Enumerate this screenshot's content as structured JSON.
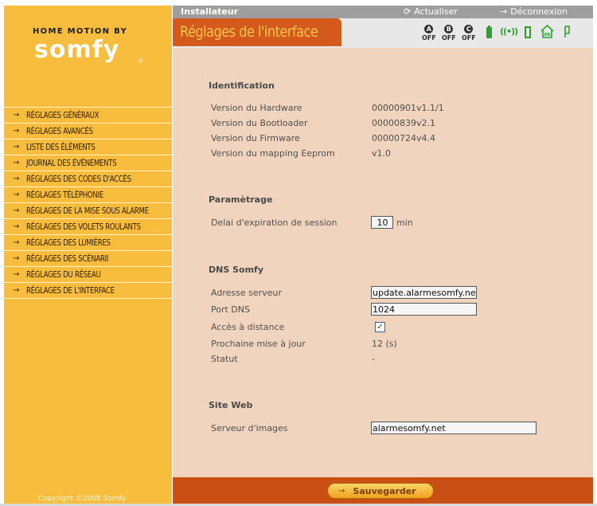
{
  "brand": {
    "tagline": "HOME MOTION BY",
    "name": "somfy",
    "reg": "®"
  },
  "sidebar": {
    "items": [
      {
        "label": "RÉGLAGES GÉNÉRAUX"
      },
      {
        "label": "RÉGLAGES AVANCÉS"
      },
      {
        "label": "LISTE DES ÉLÉMENTS"
      },
      {
        "label": "JOURNAL DES ÉVÉNEMENTS"
      },
      {
        "label": "RÉGLAGES DES CODES D'ACCÈS"
      },
      {
        "label": "RÉGLAGES TÉLÉPHONIE"
      },
      {
        "label": "RÉGLAGES DE LA MISE SOUS ALARME"
      },
      {
        "label": "RÉGLAGES DES VOLETS ROULANTS"
      },
      {
        "label": "RÉGLAGES DES LUMIÈRES"
      },
      {
        "label": "RÉGLAGES DES SCÉNARII"
      },
      {
        "label": "RÉGLAGES DU RÉSEAU"
      },
      {
        "label": "RÉGLAGES DE L'INTERFACE"
      }
    ],
    "copyright": "Copyright ©2008 Somfy"
  },
  "topbar": {
    "role": "Installateur",
    "refresh": "Actualiser",
    "logout": "Déconnexion"
  },
  "header": {
    "title": "Réglages de l'interface",
    "zones": [
      {
        "letter": "A",
        "state": "OFF"
      },
      {
        "letter": "B",
        "state": "OFF"
      },
      {
        "letter": "C",
        "state": "OFF"
      }
    ],
    "status_icons": [
      "battery-icon",
      "radio-signal-icon",
      "door-icon",
      "house-ok-icon",
      "shutter-icon"
    ],
    "house_badge": "OK"
  },
  "identification": {
    "title": "Identification",
    "rows": [
      {
        "label": "Version du Hardware",
        "value": "00000901v1.1/1"
      },
      {
        "label": "Version du Bootloader",
        "value": "00000839v2.1"
      },
      {
        "label": "Version du Firmware",
        "value": "00000724v4.4"
      },
      {
        "label": "Version du mapping Eeprom",
        "value": "v1.0"
      }
    ]
  },
  "parametrage": {
    "title": "Paramètrage",
    "session_label": "Delai d'expiration de session",
    "session_value": "10",
    "session_unit": "min"
  },
  "dns": {
    "title": "DNS Somfy",
    "server_label": "Adresse serveur",
    "server_value": "update.alarmesomfy.net",
    "port_label": "Port DNS",
    "port_value": "1024",
    "remote_label": "Accès à distance",
    "remote_checked": true,
    "next_update_label": "Prochaine mise à jour",
    "next_update_value": "12 (s)",
    "status_label": "Statut",
    "status_value": "-"
  },
  "website": {
    "title": "Site Web",
    "images_label": "Serveur d'images",
    "images_value": "alarmesomfy.net"
  },
  "footer": {
    "save_label": "Sauvegarder"
  },
  "colors": {
    "sidebar": "#f8bd3c",
    "title_tab": "#d35a1c",
    "title_text": "#f9c64a",
    "content_bg": "#f0d4bd",
    "footer": "#c94f14",
    "status_green": "#2ea02e"
  }
}
